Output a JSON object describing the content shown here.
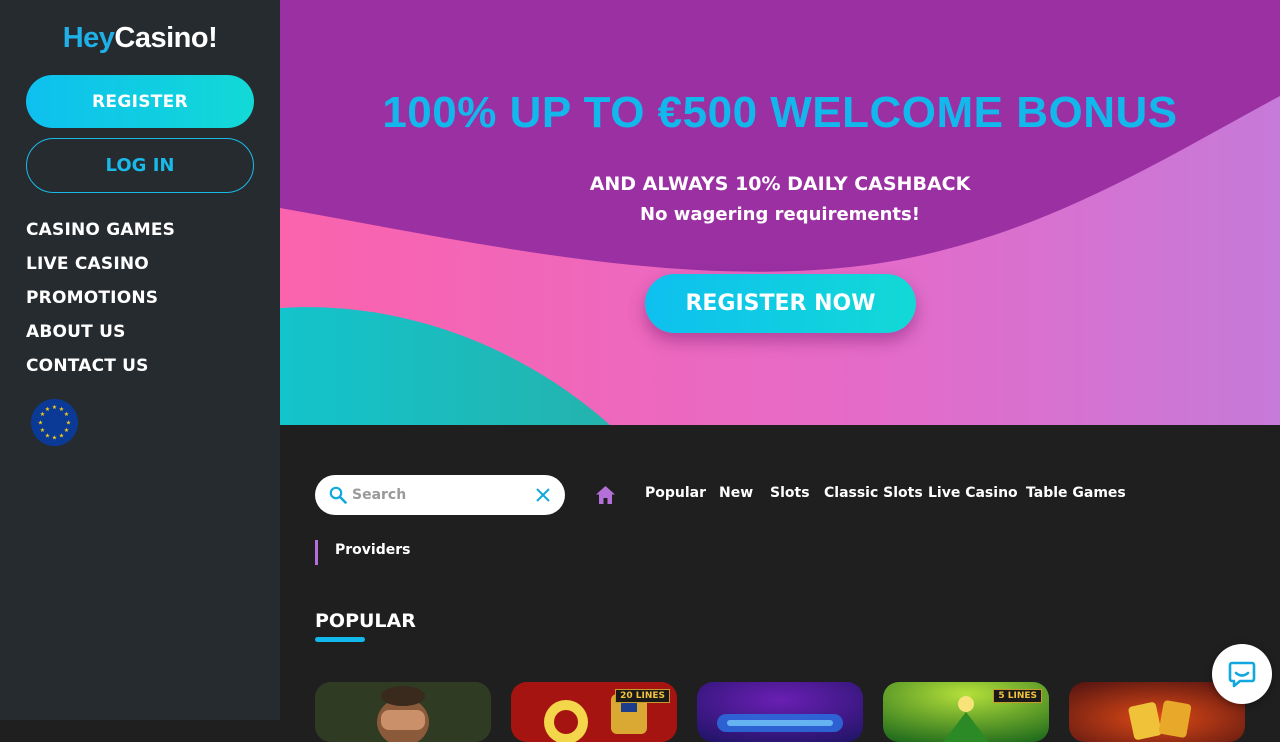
{
  "brand": {
    "logo_hey": "Hey",
    "logo_casino": "Casino!"
  },
  "sidebar": {
    "register_label": "REGISTER",
    "login_label": "LOG IN",
    "nav": [
      {
        "label": "CASINO GAMES"
      },
      {
        "label": "LIVE CASINO"
      },
      {
        "label": "PROMOTIONS"
      },
      {
        "label": "ABOUT US"
      },
      {
        "label": "CONTACT US"
      }
    ],
    "language_icon": "eu-flag-icon"
  },
  "hero": {
    "title": "100% UP TO €500 WELCOME BONUS",
    "subtitle": "AND ALWAYS 10% DAILY CASHBACK",
    "subtitle2": "No wagering requirements!",
    "cta_label": "REGISTER NOW"
  },
  "search": {
    "placeholder": "Search",
    "value": ""
  },
  "categories": [
    {
      "label": "Popular"
    },
    {
      "label": "New"
    },
    {
      "label": "Slots"
    },
    {
      "label": "Classic Slots"
    },
    {
      "label": "Live Casino"
    },
    {
      "label": "Table Games"
    }
  ],
  "providers_label": "Providers",
  "section": {
    "title": "POPULAR"
  },
  "games": [
    {
      "name": "game-tile-1",
      "badge": ""
    },
    {
      "name": "game-tile-2",
      "badge": "20 LINES"
    },
    {
      "name": "game-tile-3",
      "badge": ""
    },
    {
      "name": "game-tile-4",
      "badge": "5 LINES"
    },
    {
      "name": "game-tile-5",
      "badge": ""
    }
  ],
  "colors": {
    "accent": "#12b8ec",
    "sidebar_bg": "#262b2f",
    "hero_purple": "#9b30a3",
    "hero_pink": "#f561b4",
    "hero_teal": "#17c2c2",
    "nav_highlight": "#b46fd9"
  }
}
